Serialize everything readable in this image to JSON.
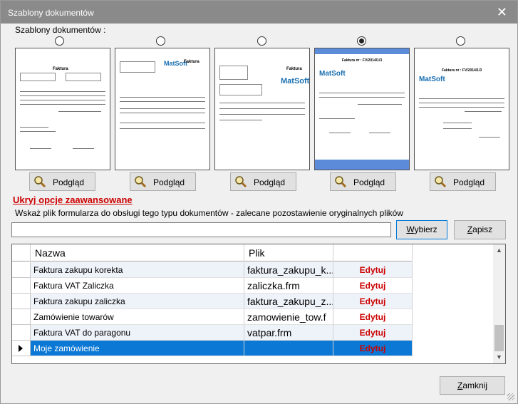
{
  "window": {
    "title": "Szablony dokumentów"
  },
  "templates": {
    "label": "Szablony dokumentów :",
    "selected_index": 3,
    "items": [
      {
        "preview_label": "Podgląd",
        "doc_title": "Faktura",
        "logo": ""
      },
      {
        "preview_label": "Podgląd",
        "doc_title": "Faktura",
        "logo": "MatSoft"
      },
      {
        "preview_label": "Podgląd",
        "doc_title": "Faktura",
        "logo": "MatSoft"
      },
      {
        "preview_label": "Podgląd",
        "doc_title": "Faktura nr : FV/2014/1/3",
        "logo": "MatSoft"
      },
      {
        "preview_label": "Podgląd",
        "doc_title": "Faktura nr : FV/2014/1/3",
        "logo": "MatSoft"
      }
    ]
  },
  "advanced": {
    "toggle_label": "Ukryj opcje zaawansowane",
    "hint": "Wskaż plik formularza do obsługi tego typu dokumentów  - zalecane pozostawienie oryginalnych plików",
    "path_value": "",
    "choose_label_u": "W",
    "choose_label_rest": "ybierz",
    "save_label_u": "Z",
    "save_label_rest": "apisz"
  },
  "grid": {
    "columns": [
      "Nazwa",
      "Plik",
      ""
    ],
    "rows": [
      {
        "name": "Faktura zakupu korekta",
        "file": "faktura_zakupu_k...",
        "action": "Edytuj"
      },
      {
        "name": "Faktura VAT Zaliczka",
        "file": "zaliczka.frm",
        "action": "Edytuj"
      },
      {
        "name": "Faktura zakupu zaliczka",
        "file": "faktura_zakupu_z...",
        "action": "Edytuj"
      },
      {
        "name": "Zamówienie towarów",
        "file": "zamowienie_tow.f",
        "action": "Edytuj"
      },
      {
        "name": "Faktura VAT do paragonu",
        "file": "vatpar.frm",
        "action": "Edytuj"
      },
      {
        "name": "Moje zamówienie",
        "file": "",
        "action": "Edytuj"
      }
    ],
    "selected_row": 5
  },
  "footer": {
    "close_label_u": "Z",
    "close_label_rest": "amknij"
  },
  "colors": {
    "title_bar": "#8a8a8a",
    "selection": "#0a78d4",
    "edit_link": "#cc0000",
    "template_selected": "#5b8bd9"
  }
}
